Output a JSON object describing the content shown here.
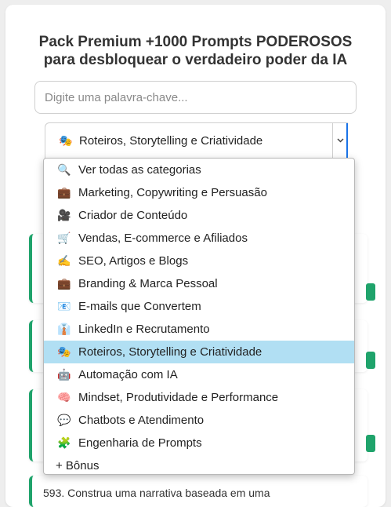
{
  "header": {
    "title_line1": "Pack Premium +1000 Prompts PODEROSOS",
    "title_line2": "para desbloquear o verdadeiro poder da IA"
  },
  "search": {
    "placeholder": "Digite uma palavra-chave...",
    "value": ""
  },
  "category_select": {
    "selected_icon": "🎭",
    "selected_label": "Roteiros, Storytelling e Criatividade",
    "arrow_icon": "chevron-down-icon"
  },
  "dropdown": {
    "options": [
      {
        "icon": "🔍",
        "label": "Ver todas as categorias"
      },
      {
        "icon": "💼",
        "label": "Marketing, Copywriting e Persuasão"
      },
      {
        "icon": "🎥",
        "label": "Criador de Conteúdo"
      },
      {
        "icon": "🛒",
        "label": "Vendas, E-commerce e Afiliados"
      },
      {
        "icon": "✍️",
        "label": "SEO, Artigos e Blogs"
      },
      {
        "icon": "💼",
        "label": "Branding & Marca Pessoal"
      },
      {
        "icon": "📧",
        "label": "E-mails que Convertem"
      },
      {
        "icon": "👔",
        "label": "LinkedIn e Recrutamento"
      },
      {
        "icon": "🎭",
        "label": "Roteiros, Storytelling e Criatividade",
        "selected": true
      },
      {
        "icon": "🤖",
        "label": "Automação com IA"
      },
      {
        "icon": "🧠",
        "label": "Mindset, Produtividade e Performance"
      },
      {
        "icon": "💬",
        "label": "Chatbots e Atendimento"
      },
      {
        "icon": "🧩",
        "label": "Engenharia de Prompts"
      },
      {
        "icon": "",
        "label": "+ Bônus"
      }
    ]
  },
  "cards": {
    "visible_text": "593. Construa uma narrativa baseada em uma"
  },
  "colors": {
    "accent_green": "#1fa36b",
    "selected_highlight": "#b1dff3",
    "focus_blue": "#1a73e8"
  }
}
